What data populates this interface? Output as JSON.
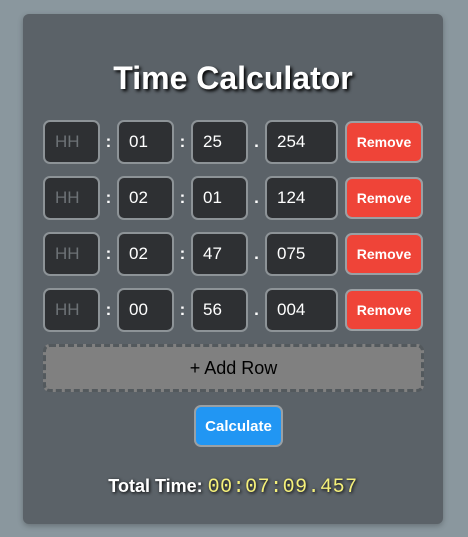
{
  "app": {
    "title": "Time Calculator"
  },
  "rows": [
    {
      "hh": "",
      "mm": "01",
      "ss": "25",
      "ms": "254"
    },
    {
      "hh": "",
      "mm": "02",
      "ss": "01",
      "ms": "124"
    },
    {
      "hh": "",
      "mm": "02",
      "ss": "47",
      "ms": "075"
    },
    {
      "hh": "",
      "mm": "00",
      "ss": "56",
      "ms": "004"
    }
  ],
  "placeholders": {
    "hh": "HH"
  },
  "separators": {
    "colon": ":",
    "dot": "."
  },
  "labels": {
    "remove": "Remove",
    "add_row": "+ Add Row",
    "calculate": "Calculate",
    "total_label": "Total Time:",
    "total_value": "00:07:09.457"
  },
  "colors": {
    "remove": "#ef4438",
    "calculate": "#2196f3",
    "total_value": "#f5f07a"
  }
}
